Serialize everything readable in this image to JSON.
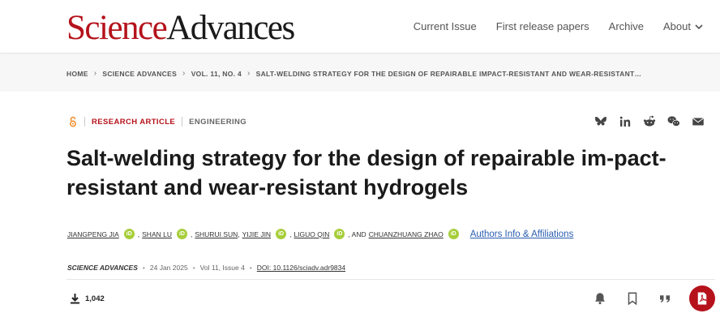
{
  "header": {
    "logo_science": "Science",
    "logo_advances": "Advances",
    "nav": [
      "Current Issue",
      "First release papers",
      "Archive"
    ],
    "nav_about": "About"
  },
  "breadcrumb": [
    "HOME",
    "SCIENCE ADVANCES",
    "VOL. 11, NO. 4",
    "SALT-WELDING STRATEGY FOR THE DESIGN OF REPAIRABLE IMPACT-RESISTANT AND WEAR-RESISTANT…"
  ],
  "article": {
    "type": "RESEARCH ARTICLE",
    "subject": "ENGINEERING",
    "title": "Salt-welding strategy for the design of repairable im-pact-resistant and wear-resistant hydrogels",
    "authors": [
      "JIANGPENG JIA",
      "SHAN LU",
      "SHURUI SUN",
      "YIJIE JIN",
      "LIGUO QIN",
      "CHUANZHUANG ZHAO"
    ],
    "and_text": ", AND",
    "affiliations_link": "Authors Info & Affiliations",
    "journal": "SCIENCE ADVANCES",
    "date": "24 Jan 2025",
    "volume": "Vol 11, Issue 4",
    "doi": "DOI: 10.1126/sciadv.adr9834",
    "downloads": "1,042"
  },
  "icons": {
    "open_access": "open-access-icon",
    "share": [
      "bluesky-icon",
      "linkedin-icon",
      "reddit-icon",
      "wechat-icon",
      "email-icon"
    ],
    "actions": [
      "bell-icon",
      "bookmark-icon",
      "quote-icon",
      "pdf-icon"
    ]
  },
  "colors": {
    "brand_red": "#b5121b",
    "orcid_green": "#a6ce39",
    "link_blue": "#2a5db0"
  }
}
